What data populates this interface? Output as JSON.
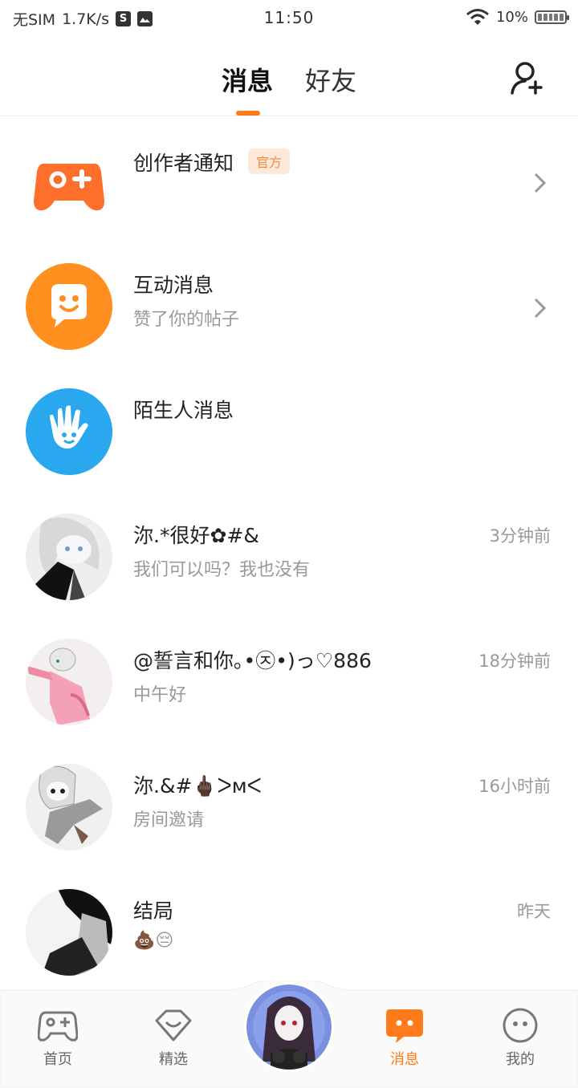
{
  "status": {
    "carrier": "无SIM",
    "speed": "1.7K/s",
    "icon_s": "S",
    "time": "11:50",
    "battery_pct": "10%",
    "battery_level": 0.1
  },
  "header": {
    "tabs": [
      {
        "label": "消息",
        "active": true
      },
      {
        "label": "好友",
        "active": false
      }
    ],
    "add_friend_icon": "add-user-icon"
  },
  "conversations": [
    {
      "title": "创作者通知",
      "badge": "官方",
      "subtitle": "",
      "time": "",
      "icon": "gamepad-icon",
      "arrow": true
    },
    {
      "title": "互动消息",
      "subtitle": "赞了你的帖子",
      "time": "",
      "icon": "chat-bubble-icon",
      "arrow": true
    },
    {
      "title": "陌生人消息",
      "subtitle": "",
      "time": "",
      "icon": "hand-icon",
      "arrow": false
    },
    {
      "title": "沵.*很好✿#&",
      "subtitle": "我们可以吗？我也没有",
      "time": "3分钟前",
      "icon": "user-avatar"
    },
    {
      "title": "@誓言和你｡•㉨•)っ♡886",
      "subtitle": "中午好",
      "time": "18分钟前",
      "icon": "user-avatar"
    },
    {
      "title": "沵.&#🖕🏿ᐳᴍᐸ",
      "subtitle": "房间邀请",
      "time": "16小时前",
      "icon": "user-avatar"
    },
    {
      "title": "结局",
      "subtitle": "💩😔",
      "time": "昨天",
      "icon": "user-avatar"
    }
  ],
  "nav": [
    {
      "label": "首页",
      "icon": "gamepad-outline-icon",
      "active": false
    },
    {
      "label": "精选",
      "icon": "heart-shield-icon",
      "active": false
    },
    {
      "label": "",
      "icon": "center-avatar",
      "active": false
    },
    {
      "label": "消息",
      "icon": "message-icon",
      "active": true
    },
    {
      "label": "我的",
      "icon": "face-icon",
      "active": false
    }
  ],
  "colors": {
    "accent": "#ff7a1a",
    "orange_icon": "#ff6f2c",
    "blue_icon": "#2aa5ee",
    "gray_text": "#999999"
  }
}
